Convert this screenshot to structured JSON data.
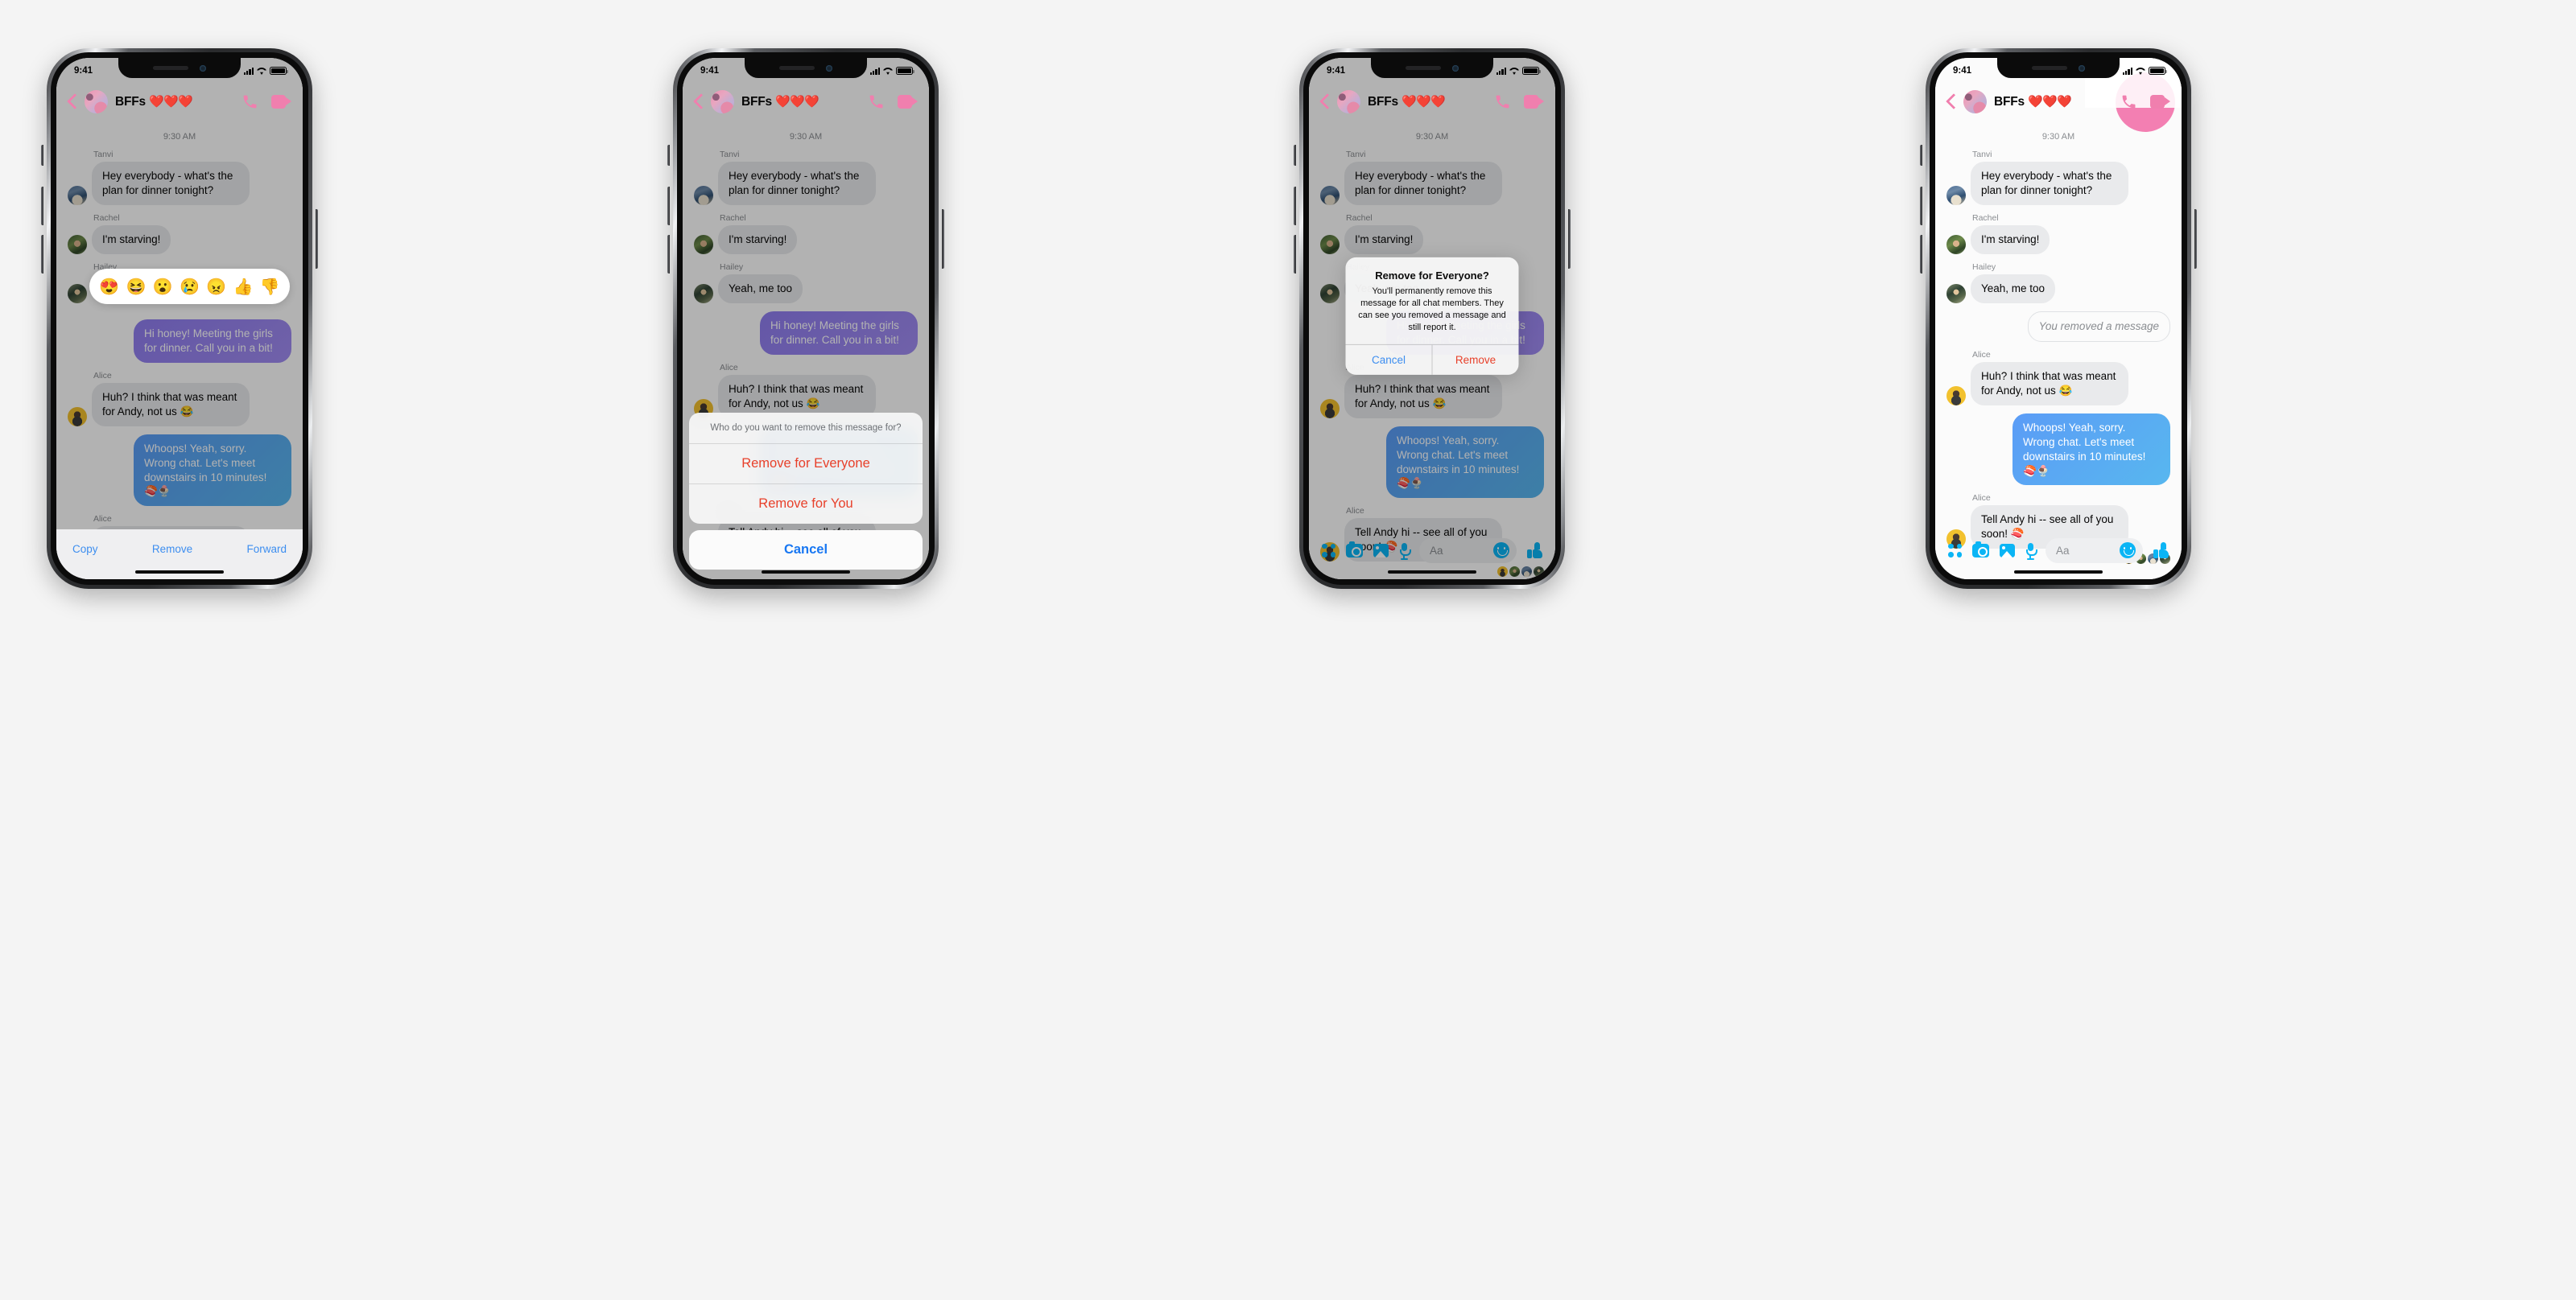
{
  "background_color": "#f4f4f4",
  "status_bar": {
    "time": "9:41",
    "cellular": "signal-bars",
    "wifi": "wifi-icon",
    "battery": "battery-icon"
  },
  "header": {
    "title": "BFFs",
    "hearts": "❤️❤️❤️",
    "back_icon": "chevron-left-icon",
    "avatar": "group-avatar",
    "call_icon": "phone-call-icon",
    "video_icon": "video-camera-icon",
    "accent_color": "#f07fae"
  },
  "conversation": {
    "timestamp": "9:30 AM",
    "messages": [
      {
        "sender": "Tanvi",
        "side": "in",
        "text": "Hey everybody - what's the plan for dinner tonight?"
      },
      {
        "sender": "Rachel",
        "side": "in",
        "text": "I'm starving!"
      },
      {
        "sender": "Hailey",
        "side": "in",
        "text": "Yeah, me too"
      },
      {
        "sender": "",
        "side": "out",
        "text": "Hi honey! Meeting the girls for dinner. Call you in a bit!",
        "style": "purple"
      },
      {
        "sender": "",
        "side": "out",
        "text": "You removed a message",
        "style": "removed"
      },
      {
        "sender": "Alice",
        "side": "in",
        "text": "Huh? I think that was meant for Andy, not us 😂"
      },
      {
        "sender": "",
        "side": "out",
        "text": "Whoops! Yeah, sorry. Wrong chat. Let's meet downstairs in 10 minutes! 🍣🍨",
        "style": "blue"
      },
      {
        "sender": "Alice",
        "side": "in",
        "text": "Tell Andy hi -- see all of you soon! 🍣"
      }
    ],
    "seen_avatars": [
      "alice",
      "rachel",
      "tanvi",
      "hailey"
    ]
  },
  "reaction_picker": {
    "emojis": [
      "😍",
      "😆",
      "😮",
      "😢",
      "😠",
      "👍",
      "👎"
    ]
  },
  "composer": {
    "placeholder": "Aa",
    "icons": [
      "four-dot-grid-icon",
      "camera-icon",
      "photo-icon",
      "microphone-icon",
      "smiley-icon",
      "thumbs-up-icon"
    ],
    "accent_color": "#0bb5f5"
  },
  "phone1": {
    "label": "long-press-action-bar",
    "actions": [
      {
        "key": "copy",
        "label": "Copy"
      },
      {
        "key": "remove",
        "label": "Remove"
      },
      {
        "key": "forward",
        "label": "Forward"
      }
    ],
    "action_color": "#3d8ef0"
  },
  "phone2": {
    "sheet_title": "Who do you want to remove this message for?",
    "options": [
      {
        "key": "remove-everyone",
        "label": "Remove for Everyone"
      },
      {
        "key": "remove-you",
        "label": "Remove for You"
      }
    ],
    "cancel": "Cancel",
    "destructive_color": "#e8402a",
    "cancel_color": "#1877f2"
  },
  "phone3": {
    "alert_title": "Remove for Everyone?",
    "alert_body": "You'll permanently remove this message for all chat members. They can see you removed a message and still report it.",
    "cancel": "Cancel",
    "remove": "Remove"
  },
  "phone4": {
    "removed_notice": "You removed a message"
  }
}
